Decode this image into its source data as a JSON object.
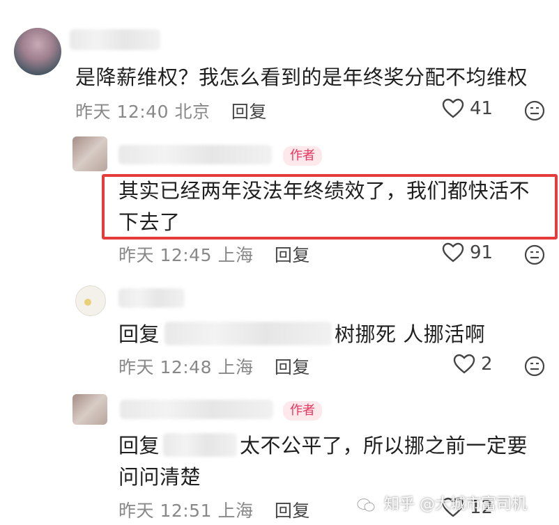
{
  "comments": [
    {
      "text": "是降薪维权？我怎么看到的是年终奖分配不均维权",
      "time": "昨天 12:40",
      "location": "北京",
      "reply_label": "回复",
      "likes": "41"
    },
    {
      "badge": "作者",
      "text_line1": "其实已经两年没法年终绩效了，我们都快活不",
      "text_line2": "下去了",
      "time": "昨天 12:45",
      "location": "上海",
      "reply_label": "回复",
      "likes": "91"
    },
    {
      "reply_prefix": "回复",
      "text": "树挪死 人挪活啊",
      "time": "昨天 12:48",
      "location": "上海",
      "reply_label": "回复",
      "likes": "2"
    },
    {
      "badge": "作者",
      "reply_prefix": "回复",
      "text_line1": "太不公平了，所以挪之前一定要",
      "text_line2": "问问清楚",
      "time": "昨天 12:51",
      "location": "上海",
      "reply_label": "回复",
      "likes": "12"
    }
  ],
  "watermark": "知乎 @大城市富司机",
  "icons": [
    "heart-icon",
    "emoji-icon",
    "zhihu-logo-icon"
  ],
  "colors": {
    "highlight": "#e53b3b",
    "badge_text": "#e6365f",
    "meta": "#888888"
  }
}
